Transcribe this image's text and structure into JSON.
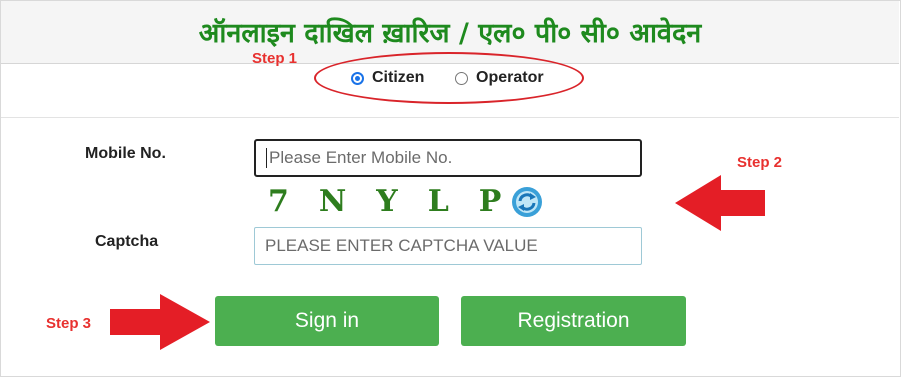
{
  "header": {
    "title": "ऑनलाइन दाखिल ख़ारिज / एल० पी० सी० आवेदन"
  },
  "annotations": {
    "step1": "Step 1",
    "step2": "Step 2",
    "step3": "Step 3",
    "color": "#e8312f"
  },
  "login_type": {
    "options": [
      {
        "label": "Citizen",
        "selected": true
      },
      {
        "label": "Operator",
        "selected": false
      }
    ]
  },
  "form": {
    "mobile_label": "Mobile No.",
    "mobile_placeholder": "Please Enter Mobile No.",
    "captcha_label": "Captcha",
    "captcha_text": "7NYLP",
    "captcha_placeholder": "PLEASE ENTER CAPTCHA VALUE"
  },
  "buttons": {
    "signin": "Sign in",
    "registration": "Registration"
  },
  "colors": {
    "title": "#1e8a1e",
    "button": "#4caf50",
    "captcha": "#2e7d1e",
    "refresh": "#3aa0d8"
  }
}
